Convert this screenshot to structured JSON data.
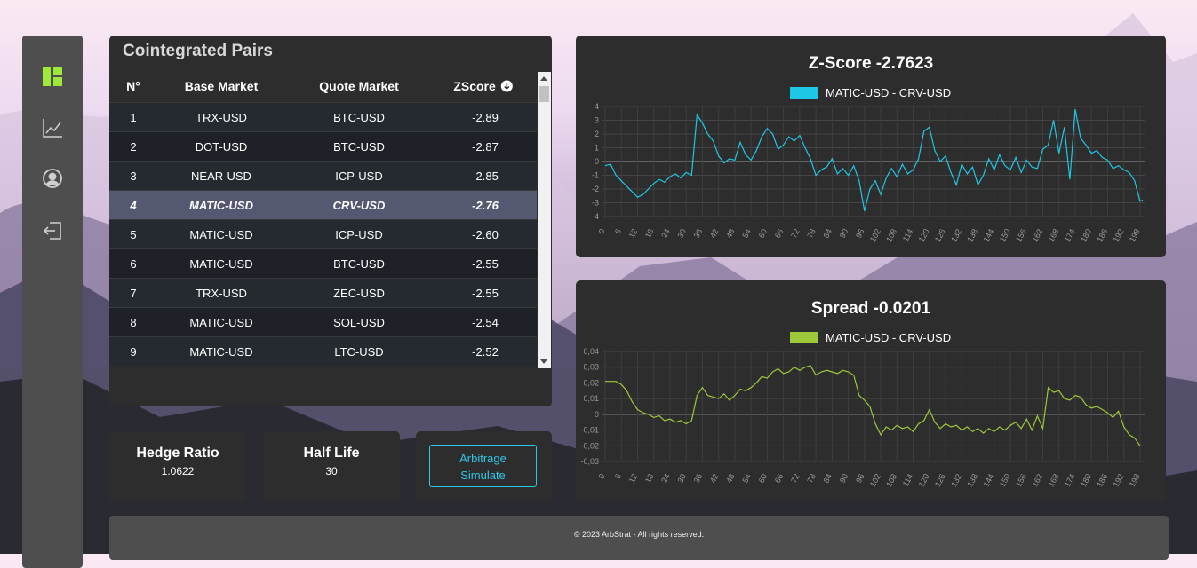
{
  "sidebar": {
    "items": [
      {
        "icon": "dashboard-icon",
        "active": true,
        "color": "#9ee93a"
      },
      {
        "icon": "line-chart-icon",
        "active": false
      },
      {
        "icon": "user-icon",
        "active": false
      },
      {
        "icon": "logout-icon",
        "active": false
      }
    ]
  },
  "pairs": {
    "title": "Cointegrated Pairs",
    "columns": [
      "N°",
      "Base Market",
      "Quote Market",
      "ZScore"
    ],
    "sort_icon": "sort-down-icon",
    "rows": [
      {
        "n": "1",
        "base": "TRX-USD",
        "quote": "BTC-USD",
        "zscore": "-2.89"
      },
      {
        "n": "2",
        "base": "DOT-USD",
        "quote": "BTC-USD",
        "zscore": "-2.87"
      },
      {
        "n": "3",
        "base": "NEAR-USD",
        "quote": "ICP-USD",
        "zscore": "-2.85"
      },
      {
        "n": "4",
        "base": "MATIC-USD",
        "quote": "CRV-USD",
        "zscore": "-2.76",
        "selected": true
      },
      {
        "n": "5",
        "base": "MATIC-USD",
        "quote": "ICP-USD",
        "zscore": "-2.60"
      },
      {
        "n": "6",
        "base": "MATIC-USD",
        "quote": "BTC-USD",
        "zscore": "-2.55"
      },
      {
        "n": "7",
        "base": "TRX-USD",
        "quote": "ZEC-USD",
        "zscore": "-2.55"
      },
      {
        "n": "8",
        "base": "MATIC-USD",
        "quote": "SOL-USD",
        "zscore": "-2.54"
      },
      {
        "n": "9",
        "base": "MATIC-USD",
        "quote": "LTC-USD",
        "zscore": "-2.52"
      }
    ]
  },
  "hedge": {
    "label": "Hedge Ratio",
    "value": "1.0622"
  },
  "halflife": {
    "label": "Half Life",
    "value": "30"
  },
  "simulate": {
    "line1": "Arbitrage",
    "line2": "Simulate"
  },
  "footer": {
    "text": "© 2023 ArbStrat - All rights reserved."
  },
  "chart_data": [
    {
      "type": "line",
      "title": "Z-Score -2.7623",
      "series": [
        {
          "name": "MATIC-USD - CRV-USD",
          "color": "#1fc7e6"
        }
      ],
      "ylim": [
        -4,
        4
      ],
      "yticks": [
        "4",
        "3",
        "2",
        "1",
        "0",
        "-1",
        "-2",
        "-3",
        "-4"
      ],
      "xticks": [
        "0",
        "6",
        "12",
        "18",
        "24",
        "30",
        "36",
        "42",
        "48",
        "54",
        "60",
        "66",
        "72",
        "78",
        "84",
        "90",
        "96",
        "102",
        "108",
        "114",
        "120",
        "126",
        "132",
        "138",
        "144",
        "150",
        "156",
        "162",
        "168",
        "174",
        "180",
        "186",
        "192",
        "198"
      ],
      "x_range": [
        0,
        200
      ],
      "points": [
        [
          0,
          -0.3
        ],
        [
          2,
          -0.2
        ],
        [
          4,
          -1.0
        ],
        [
          6,
          -1.4
        ],
        [
          8,
          -1.8
        ],
        [
          10,
          -2.2
        ],
        [
          12,
          -2.6
        ],
        [
          14,
          -2.4
        ],
        [
          16,
          -2.0
        ],
        [
          18,
          -1.6
        ],
        [
          20,
          -1.3
        ],
        [
          22,
          -1.5
        ],
        [
          24,
          -1.1
        ],
        [
          26,
          -0.9
        ],
        [
          28,
          -1.2
        ],
        [
          30,
          -0.8
        ],
        [
          32,
          -1.0
        ],
        [
          34,
          3.4
        ],
        [
          36,
          2.8
        ],
        [
          38,
          2.0
        ],
        [
          40,
          1.5
        ],
        [
          42,
          0.4
        ],
        [
          44,
          -0.1
        ],
        [
          46,
          0.2
        ],
        [
          48,
          0.1
        ],
        [
          50,
          1.4
        ],
        [
          52,
          0.5
        ],
        [
          54,
          0.1
        ],
        [
          56,
          0.8
        ],
        [
          58,
          1.8
        ],
        [
          60,
          2.4
        ],
        [
          62,
          2.0
        ],
        [
          64,
          0.9
        ],
        [
          66,
          1.2
        ],
        [
          68,
          1.8
        ],
        [
          70,
          1.5
        ],
        [
          72,
          1.9
        ],
        [
          74,
          1.0
        ],
        [
          76,
          0.2
        ],
        [
          78,
          -1.0
        ],
        [
          80,
          -0.6
        ],
        [
          82,
          -0.4
        ],
        [
          84,
          0.2
        ],
        [
          86,
          -0.9
        ],
        [
          88,
          -0.5
        ],
        [
          90,
          -1.0
        ],
        [
          92,
          -0.3
        ],
        [
          94,
          -1.4
        ],
        [
          96,
          -3.6
        ],
        [
          98,
          -2.0
        ],
        [
          100,
          -1.4
        ],
        [
          102,
          -2.4
        ],
        [
          104,
          -1.2
        ],
        [
          106,
          -0.5
        ],
        [
          108,
          -1.1
        ],
        [
          110,
          -0.2
        ],
        [
          112,
          -0.9
        ],
        [
          114,
          -0.6
        ],
        [
          116,
          0.2
        ],
        [
          118,
          2.2
        ],
        [
          120,
          2.5
        ],
        [
          122,
          0.8
        ],
        [
          124,
          0.0
        ],
        [
          126,
          0.4
        ],
        [
          128,
          -0.8
        ],
        [
          130,
          -1.7
        ],
        [
          132,
          -0.2
        ],
        [
          134,
          -0.9
        ],
        [
          136,
          -0.4
        ],
        [
          138,
          -1.7
        ],
        [
          140,
          -1.0
        ],
        [
          142,
          0.2
        ],
        [
          144,
          -0.6
        ],
        [
          146,
          0.5
        ],
        [
          148,
          -0.3
        ],
        [
          150,
          -0.6
        ],
        [
          152,
          0.3
        ],
        [
          154,
          -0.8
        ],
        [
          156,
          0.1
        ],
        [
          158,
          -0.4
        ],
        [
          160,
          -0.5
        ],
        [
          162,
          0.9
        ],
        [
          164,
          1.2
        ],
        [
          166,
          3.0
        ],
        [
          168,
          0.6
        ],
        [
          170,
          2.5
        ],
        [
          172,
          -1.3
        ],
        [
          174,
          3.8
        ],
        [
          176,
          1.7
        ],
        [
          178,
          1.2
        ],
        [
          180,
          0.6
        ],
        [
          182,
          0.8
        ],
        [
          184,
          0.3
        ],
        [
          186,
          0.1
        ],
        [
          188,
          -0.5
        ],
        [
          190,
          -0.3
        ],
        [
          192,
          -0.6
        ],
        [
          194,
          -0.8
        ],
        [
          196,
          -1.4
        ],
        [
          198,
          -2.9
        ],
        [
          199,
          -2.8
        ]
      ]
    },
    {
      "type": "line",
      "title": "Spread -0.0201",
      "series": [
        {
          "name": "MATIC-USD - CRV-USD",
          "color": "#9bc93a"
        }
      ],
      "ylim": [
        -0.03,
        0.04
      ],
      "yticks": [
        "0,04",
        "0,03",
        "0,02",
        "0,01",
        "0",
        "-0,01",
        "-0,02",
        "-0,03"
      ],
      "xticks": [
        "0",
        "6",
        "12",
        "18",
        "24",
        "30",
        "36",
        "42",
        "48",
        "54",
        "60",
        "66",
        "72",
        "78",
        "84",
        "90",
        "96",
        "102",
        "108",
        "114",
        "120",
        "126",
        "132",
        "138",
        "144",
        "150",
        "156",
        "162",
        "168",
        "174",
        "180",
        "186",
        "192",
        "198"
      ],
      "x_range": [
        0,
        200
      ],
      "points": [
        [
          0,
          0.021
        ],
        [
          4,
          0.021
        ],
        [
          6,
          0.019
        ],
        [
          8,
          0.015
        ],
        [
          10,
          0.008
        ],
        [
          12,
          0.003
        ],
        [
          14,
          0.001
        ],
        [
          16,
          0.0
        ],
        [
          18,
          -0.002
        ],
        [
          20,
          -0.001
        ],
        [
          22,
          -0.004
        ],
        [
          24,
          -0.003
        ],
        [
          26,
          -0.005
        ],
        [
          28,
          -0.004
        ],
        [
          30,
          -0.006
        ],
        [
          32,
          -0.004
        ],
        [
          34,
          0.012
        ],
        [
          36,
          0.017
        ],
        [
          38,
          0.012
        ],
        [
          40,
          0.011
        ],
        [
          42,
          0.01
        ],
        [
          44,
          0.013
        ],
        [
          46,
          0.009
        ],
        [
          48,
          0.012
        ],
        [
          50,
          0.016
        ],
        [
          52,
          0.015
        ],
        [
          54,
          0.017
        ],
        [
          56,
          0.02
        ],
        [
          58,
          0.024
        ],
        [
          60,
          0.023
        ],
        [
          62,
          0.027
        ],
        [
          64,
          0.029
        ],
        [
          66,
          0.026
        ],
        [
          68,
          0.027
        ],
        [
          70,
          0.03
        ],
        [
          72,
          0.028
        ],
        [
          74,
          0.03
        ],
        [
          76,
          0.031
        ],
        [
          78,
          0.025
        ],
        [
          80,
          0.027
        ],
        [
          82,
          0.028
        ],
        [
          84,
          0.027
        ],
        [
          86,
          0.026
        ],
        [
          88,
          0.028
        ],
        [
          90,
          0.027
        ],
        [
          92,
          0.025
        ],
        [
          94,
          0.012
        ],
        [
          96,
          0.009
        ],
        [
          98,
          0.005
        ],
        [
          100,
          -0.006
        ],
        [
          102,
          -0.013
        ],
        [
          104,
          -0.008
        ],
        [
          106,
          -0.01
        ],
        [
          108,
          -0.007
        ],
        [
          110,
          -0.009
        ],
        [
          112,
          -0.008
        ],
        [
          114,
          -0.011
        ],
        [
          116,
          -0.006
        ],
        [
          118,
          -0.004
        ],
        [
          120,
          0.003
        ],
        [
          122,
          -0.005
        ],
        [
          124,
          -0.009
        ],
        [
          126,
          -0.006
        ],
        [
          128,
          -0.008
        ],
        [
          130,
          -0.007
        ],
        [
          132,
          -0.01
        ],
        [
          134,
          -0.008
        ],
        [
          136,
          -0.011
        ],
        [
          138,
          -0.009
        ],
        [
          140,
          -0.012
        ],
        [
          142,
          -0.009
        ],
        [
          144,
          -0.011
        ],
        [
          146,
          -0.008
        ],
        [
          148,
          -0.01
        ],
        [
          150,
          -0.007
        ],
        [
          152,
          -0.005
        ],
        [
          154,
          -0.009
        ],
        [
          156,
          -0.003
        ],
        [
          158,
          -0.01
        ],
        [
          160,
          -0.001
        ],
        [
          162,
          -0.009
        ],
        [
          164,
          0.017
        ],
        [
          166,
          0.014
        ],
        [
          168,
          0.015
        ],
        [
          170,
          0.01
        ],
        [
          172,
          0.009
        ],
        [
          174,
          0.012
        ],
        [
          176,
          0.011
        ],
        [
          178,
          0.006
        ],
        [
          180,
          0.004
        ],
        [
          182,
          0.005
        ],
        [
          184,
          0.003
        ],
        [
          186,
          0.001
        ],
        [
          188,
          -0.002
        ],
        [
          190,
          0.002
        ],
        [
          192,
          -0.008
        ],
        [
          194,
          -0.013
        ],
        [
          196,
          -0.015
        ],
        [
          198,
          -0.02
        ]
      ]
    }
  ]
}
